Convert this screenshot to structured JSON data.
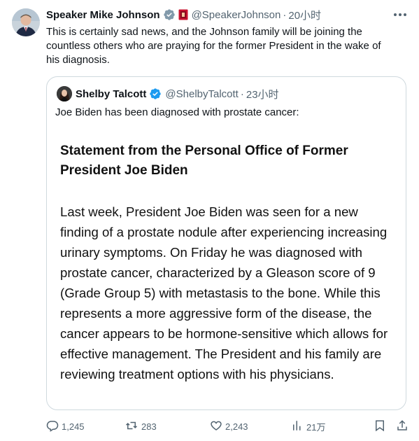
{
  "tweet": {
    "author_name": "Speaker Mike Johnson",
    "author_handle": "@SpeakerJohnson",
    "separator": "·",
    "time": "20小时",
    "text": "This is certainly sad news, and the Johnson family will be joining the countless others who are praying for the former President in the wake of his diagnosis."
  },
  "quote": {
    "author_name": "Shelby Talcott",
    "author_handle": "@ShelbyTalcott",
    "separator": "·",
    "time": "23小时",
    "text": "Joe Biden has been diagnosed with prostate cancer:",
    "statement_title": "Statement from the Personal Office of Former President Joe Biden",
    "statement_body": "Last week, President Joe Biden was seen for a new finding of a prostate nodule after experiencing increasing urinary symptoms. On Friday he was diagnosed with prostate cancer, characterized by a Gleason score of 9 (Grade Group 5) with metastasis to the bone. While this represents a more aggressive form of the disease, the cancer appears to be hormone-sensitive which allows for effective management. The President and his family are reviewing treatment options with his physicians."
  },
  "actions": {
    "replies": "1,245",
    "reposts": "283",
    "likes": "2,243",
    "views": "21万"
  },
  "colors": {
    "verified_blue": "#1d9bf0",
    "secondary_text": "#536471",
    "border": "#cfd9de",
    "affiliation_red": "#c8102e"
  },
  "icons": [
    "verified-badge-icon",
    "government-affiliation-icon",
    "more-options-icon",
    "reply-icon",
    "repost-icon",
    "like-icon",
    "views-icon",
    "bookmark-icon",
    "share-icon"
  ]
}
